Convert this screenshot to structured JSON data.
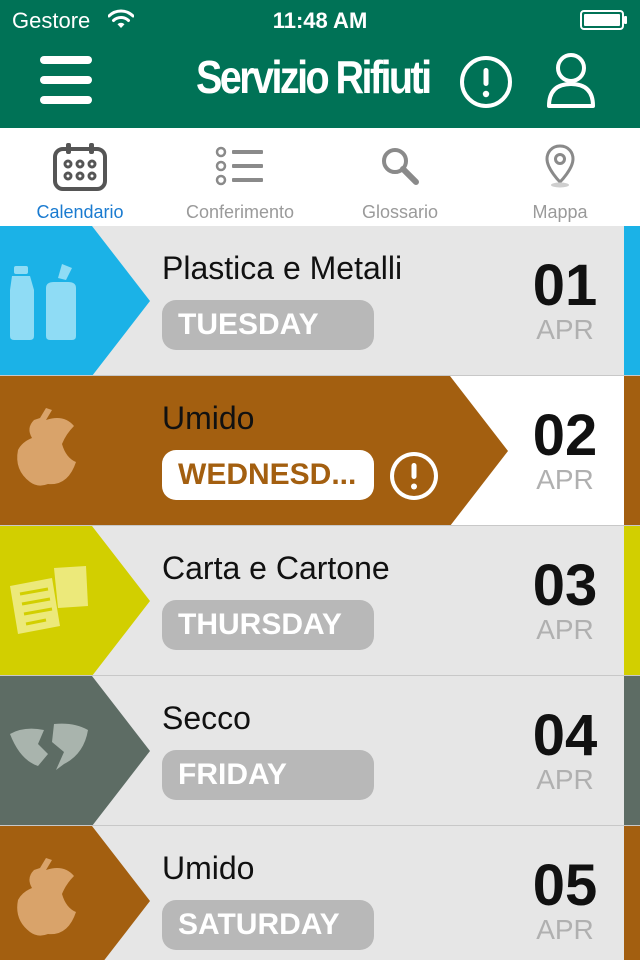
{
  "status_bar": {
    "carrier": "Gestore",
    "time": "11:48 AM"
  },
  "header": {
    "title": "Servizio Rifiuti",
    "icons": [
      "menu-icon",
      "alert-icon",
      "user-icon"
    ]
  },
  "tabs": [
    {
      "label": "Calendario",
      "icon": "calendar-icon",
      "active": true
    },
    {
      "label": "Conferimento",
      "icon": "list-icon",
      "active": false
    },
    {
      "label": "Glossario",
      "icon": "search-icon",
      "active": false
    },
    {
      "label": "Mappa",
      "icon": "map-pin-icon",
      "active": false
    }
  ],
  "colors": {
    "header": "#007256",
    "tab_active": "#1a7bd0",
    "plastica": "#1bb2e7",
    "umido": "#a35f10",
    "carta": "#d2cf00",
    "secco": "#5d6c64"
  },
  "rows": [
    {
      "name": "Plastica e Metalli",
      "day": "TUESDAY",
      "date": "01",
      "month": "APR",
      "icon": "plastic-bottles-icon",
      "highlight": false,
      "alert": false
    },
    {
      "name": "Umido",
      "day": "WEDNESD...",
      "date": "02",
      "month": "APR",
      "icon": "apple-core-icon",
      "highlight": true,
      "alert": true
    },
    {
      "name": "Carta e Cartone",
      "day": "THURSDAY",
      "date": "03",
      "month": "APR",
      "icon": "paper-icon",
      "highlight": false,
      "alert": false
    },
    {
      "name": "Secco",
      "day": "FRIDAY",
      "date": "04",
      "month": "APR",
      "icon": "broken-plate-icon",
      "highlight": false,
      "alert": false
    },
    {
      "name": "Umido",
      "day": "SATURDAY",
      "date": "05",
      "month": "APR",
      "icon": "apple-core-icon",
      "highlight": false,
      "alert": false
    }
  ]
}
